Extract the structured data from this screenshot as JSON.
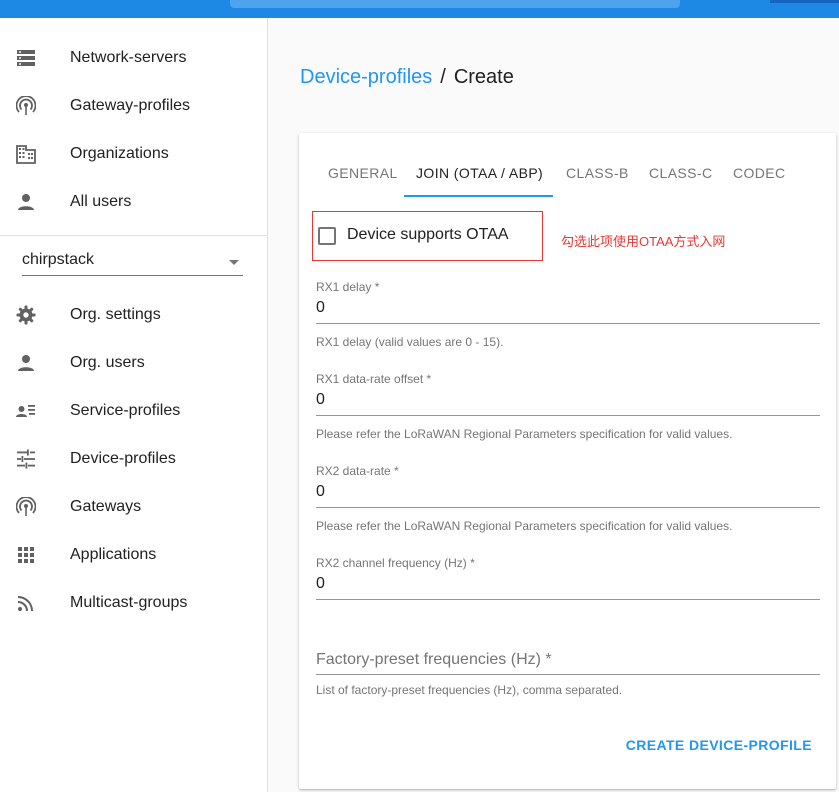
{
  "sidebar": {
    "items": [
      {
        "label": "Network-servers",
        "icon": "server-icon"
      },
      {
        "label": "Gateway-profiles",
        "icon": "antenna-icon"
      },
      {
        "label": "Organizations",
        "icon": "building-icon"
      },
      {
        "label": "All users",
        "icon": "person-icon"
      }
    ],
    "org_select": {
      "value": "chirpstack"
    },
    "org_items": [
      {
        "label": "Org. settings",
        "icon": "gear-icon"
      },
      {
        "label": "Org. users",
        "icon": "person-icon"
      },
      {
        "label": "Service-profiles",
        "icon": "account-list-icon"
      },
      {
        "label": "Device-profiles",
        "icon": "tune-icon"
      },
      {
        "label": "Gateways",
        "icon": "antenna-icon"
      },
      {
        "label": "Applications",
        "icon": "apps-grid-icon"
      },
      {
        "label": "Multicast-groups",
        "icon": "rss-icon"
      }
    ]
  },
  "breadcrumb": {
    "parent": "Device-profiles",
    "separator": "/",
    "current": "Create"
  },
  "tabs": [
    {
      "label": "GENERAL"
    },
    {
      "label": "JOIN (OTAA / ABP)"
    },
    {
      "label": "CLASS-B"
    },
    {
      "label": "CLASS-C"
    },
    {
      "label": "CODEC"
    }
  ],
  "active_tab": "JOIN (OTAA / ABP)",
  "otaa": {
    "label": "Device supports OTAA",
    "checked": false,
    "annotation": "勾选此项使用OTAA方式入网"
  },
  "fields": {
    "rx1_delay": {
      "label": "RX1 delay *",
      "value": "0",
      "helper": "RX1 delay (valid values are 0 - 15)."
    },
    "rx1_dr_offset": {
      "label": "RX1 data-rate offset *",
      "value": "0",
      "helper": "Please refer the LoRaWAN Regional Parameters specification for valid values."
    },
    "rx2_dr": {
      "label": "RX2 data-rate *",
      "value": "0",
      "helper": "Please refer the LoRaWAN Regional Parameters specification for valid values."
    },
    "rx2_freq": {
      "label": "RX2 channel frequency (Hz) *",
      "value": "0"
    },
    "factory_freq": {
      "placeholder": "Factory-preset frequencies (Hz) *",
      "helper": "List of factory-preset frequencies (Hz), comma separated."
    }
  },
  "create_button": "CREATE DEVICE-PROFILE",
  "colors": {
    "primary": "#2196f3",
    "topbar": "#1e88e5",
    "annotation": "#e53935"
  }
}
